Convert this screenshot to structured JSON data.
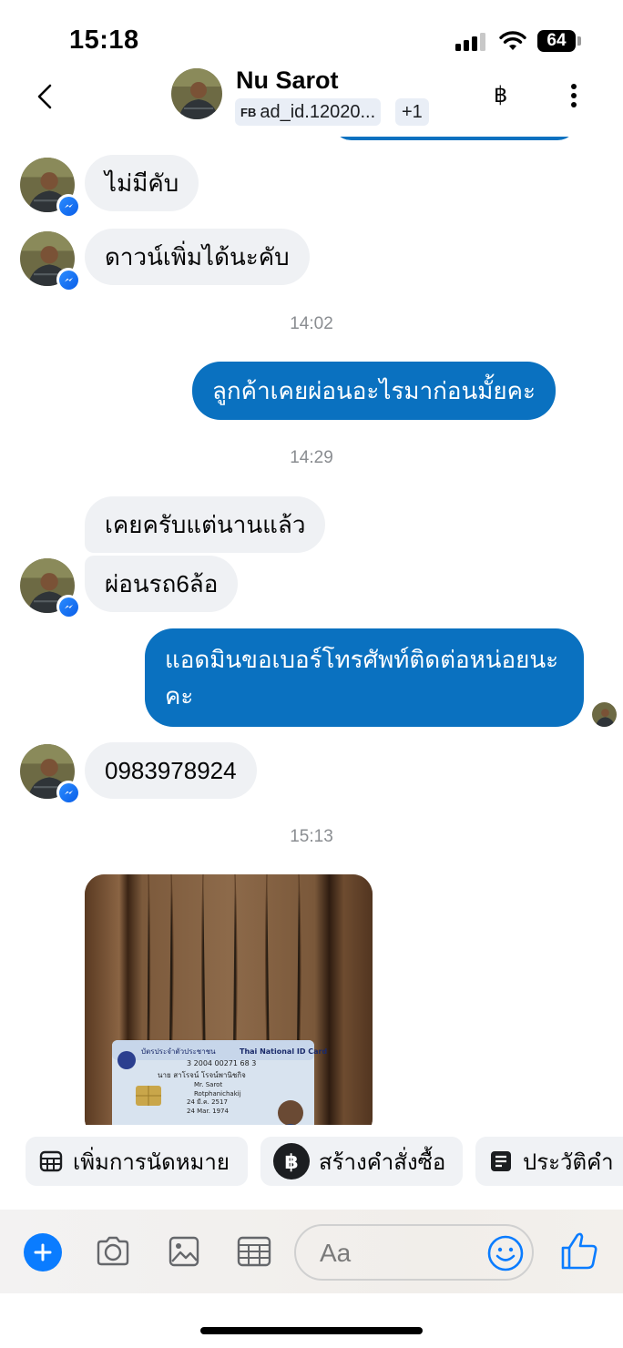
{
  "status": {
    "time": "15:18",
    "battery": "64"
  },
  "header": {
    "name": "Nu Sarot",
    "ad_badge": "FB",
    "ad_label": "ad_id.12020...",
    "extra_count": "+1",
    "baht_icon": "฿"
  },
  "messages": {
    "m1": "ไม่มีคับ",
    "m2": "ดาวน์เพิ่มได้นะคับ",
    "t1": "14:02",
    "m3": "ลูกค้าเคยผ่อนอะไรมาก่อนมั้ยคะ",
    "t2": "14:29",
    "m4": "เคยครับแต่นานแล้ว",
    "m5": "ผ่อนรถ6ล้อ",
    "m6": "แอดมินขอเบอร์โทรศัพท์ติดต่อหน่อยนะคะ",
    "m7": "0983978924",
    "t3": "15:13"
  },
  "photo_card": {
    "title_th": "บัตรประจำตัวประชาชน",
    "title_en": "Thai National ID Card",
    "id_number": "3 2004 00271 68 3",
    "name_th": "นาย สาโรจน์ โรจน์พานิชกิจ",
    "name_en": "Mr. Sarot",
    "last_name": "Rotphanichakij",
    "dob_th": "24 มี.ค. 2517",
    "dob_en": "24 Mar. 1974"
  },
  "quick_actions": [
    {
      "label": "เพิ่มการนัดหมาย",
      "icon": "calendar-grid-icon"
    },
    {
      "label": "สร้างคำสั่งซื้อ",
      "icon": "baht-circle-icon"
    },
    {
      "label": "ประวัติคำ",
      "icon": "document-list-icon"
    }
  ],
  "composer": {
    "placeholder": "Aa"
  },
  "colors": {
    "outgoing": "#0a71c0",
    "incoming": "#eff1f4",
    "accent": "#0a7cff"
  }
}
